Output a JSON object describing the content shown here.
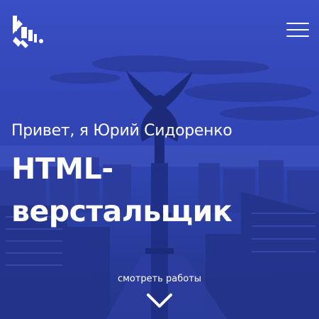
{
  "header": {
    "logo_icon": "zebra-stripes-logo-icon",
    "menu_icon": "hamburger-menu-icon"
  },
  "hero": {
    "greeting": "Привет, я Юрий Сидоренко",
    "headline_line1": "HTML-",
    "headline_line2": "верстальщик",
    "works_link": "смотреть работы",
    "chevron_icon": "chevron-down-icon"
  },
  "colors": {
    "overlay": "#3346b8",
    "text": "#ffffff"
  }
}
